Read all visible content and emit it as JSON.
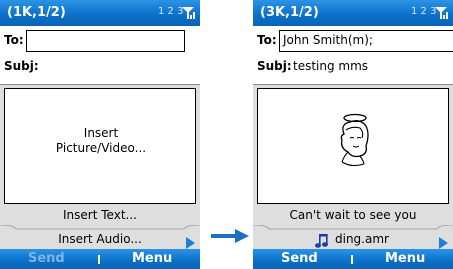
{
  "screens": [
    {
      "title": "(1K,1/2)",
      "input_mode": "1 2 3",
      "to_label": "To:",
      "to_value": "",
      "subj_label": "Subj:",
      "subj_value": "",
      "slide_placeholder_line1": "Insert",
      "slide_placeholder_line2": "Picture/Video...",
      "text_line": "Insert Text...",
      "audio_line": "Insert Audio...",
      "softkey_left": "Send",
      "softkey_right": "Menu"
    },
    {
      "title": "(3K,1/2)",
      "input_mode": "1 2 3",
      "to_label": "To:",
      "to_value": "John Smith(m);",
      "subj_label": "Subj:",
      "subj_value": "testing mms",
      "text_line": "Can't wait to see you",
      "audio_line": "ding.amr",
      "softkey_left": "Send",
      "softkey_right": "Menu"
    }
  ],
  "colors": {
    "title_bar": "#0a6fc8",
    "disabled_softkey": "#7fb4e6",
    "accent_arrow": "#1e7fd6"
  },
  "icons": [
    "signal-strength-icon",
    "next-slide-arrow-icon",
    "music-note-icon",
    "angel-picture",
    "transition-arrow-icon"
  ]
}
